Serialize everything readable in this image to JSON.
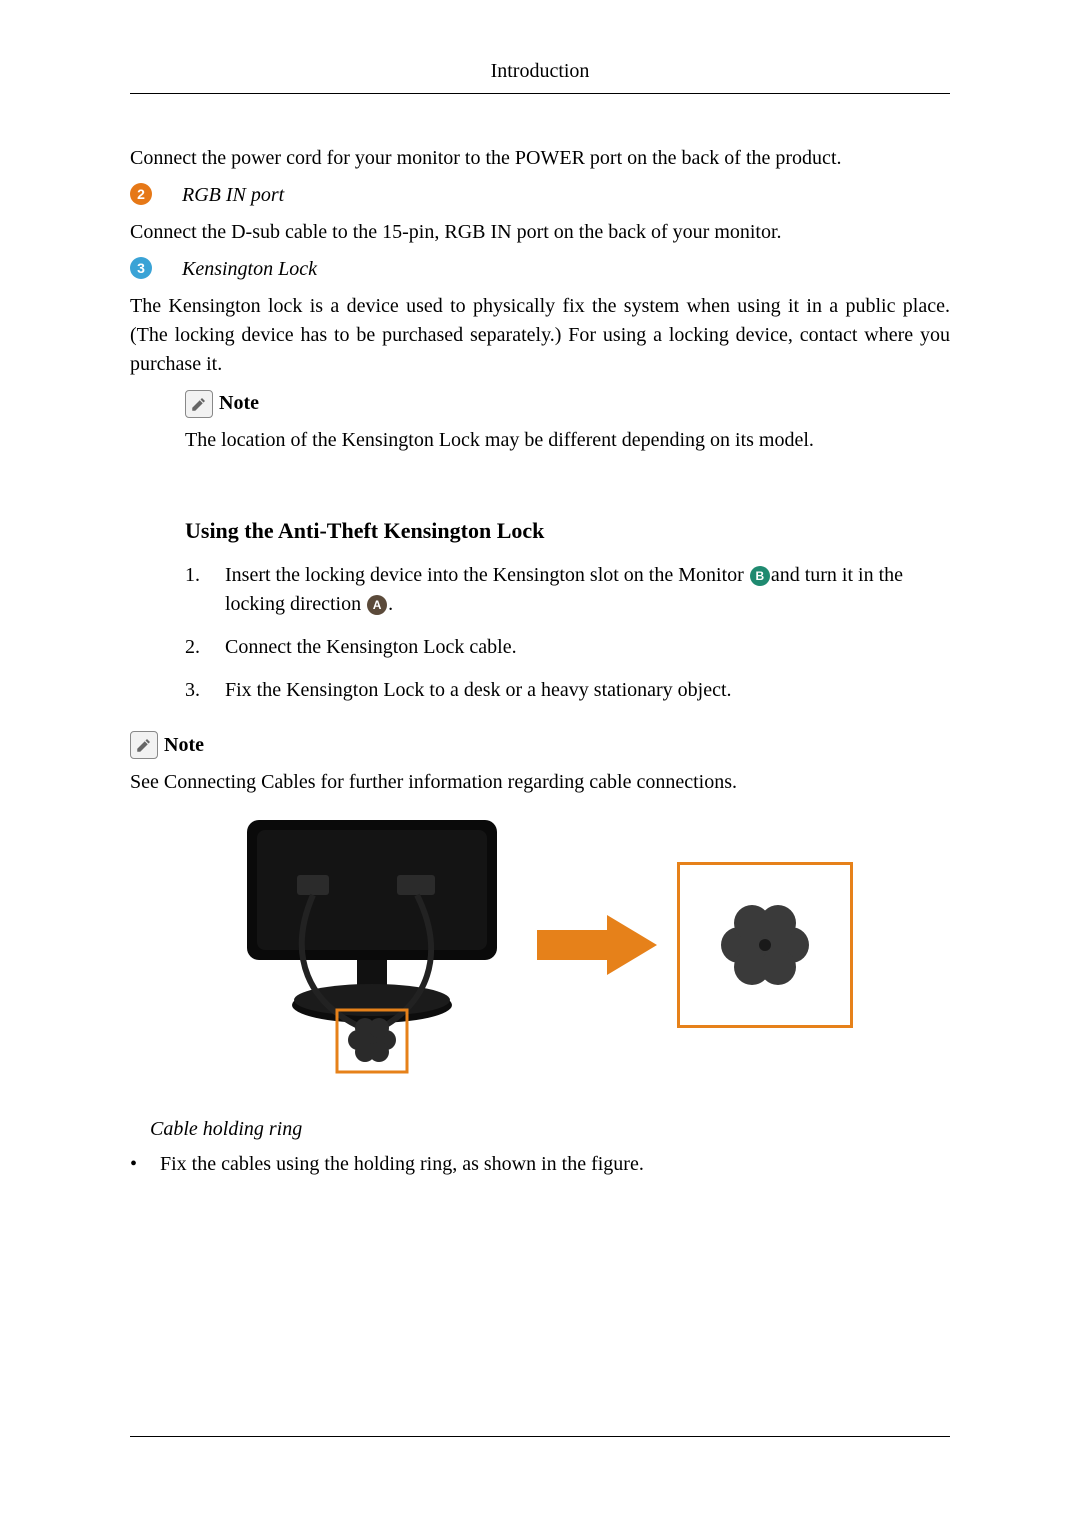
{
  "header": {
    "title": "Introduction"
  },
  "body": {
    "power_text": "Connect the power cord for your monitor to the POWER port on the back of the product.",
    "item2": {
      "num": "2",
      "title": "RGB IN port",
      "text": "Connect the D-sub cable to the 15-pin, RGB IN port on the back of your monitor."
    },
    "item3": {
      "num": "3",
      "title": "Kensington Lock",
      "text": "The Kensington lock is a device used to physically fix the system when using it in a public place. (The locking device has to be purchased separately.) For using a locking device, contact where you purchase it."
    },
    "note1": {
      "label": "Note",
      "text": "The location of the Kensington Lock may be different depending on its model."
    },
    "section_heading": "Using the Anti-Theft Kensington Lock",
    "steps": {
      "s1": {
        "num": "1.",
        "pre": "Insert the locking device into the Kensington slot on the Monitor ",
        "badgeB": "B",
        "mid": "and turn it in the locking direction ",
        "badgeA": "A",
        "post": "."
      },
      "s2": {
        "num": "2.",
        "text": "Connect the Kensington Lock cable."
      },
      "s3": {
        "num": "3.",
        "text": "Fix the Kensington Lock to a desk or a heavy stationary object."
      }
    },
    "note2": {
      "label": "Note",
      "text": "See Connecting Cables for further information regarding cable connections."
    },
    "cable": {
      "heading": "Cable holding ring",
      "bullet": "Fix the cables using the holding ring, as shown in the figure."
    }
  }
}
